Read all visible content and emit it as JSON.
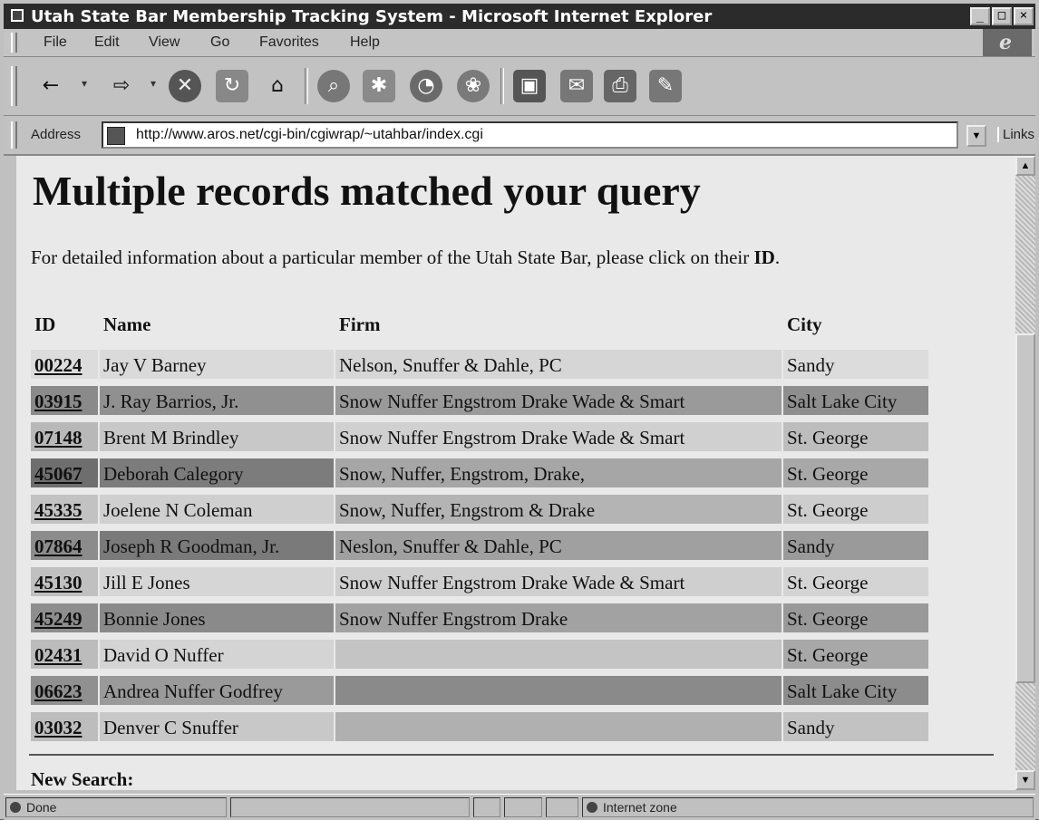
{
  "window": {
    "title": "Utah State Bar Membership Tracking System - Microsoft Internet Explorer"
  },
  "menu": [
    "File",
    "Edit",
    "View",
    "Go",
    "Favorites",
    "Help"
  ],
  "toolbar_icons": [
    "back-icon",
    "forward-icon",
    "stop-icon",
    "refresh-icon",
    "home-icon",
    "search-icon",
    "favorites-icon",
    "history-icon",
    "channels-icon",
    "fullscreen-icon",
    "mail-icon",
    "print-icon",
    "edit-icon"
  ],
  "address": {
    "label": "Address",
    "url": "http://www.aros.net/cgi-bin/cgiwrap/~utahbar/index.cgi",
    "links": "Links"
  },
  "page": {
    "heading": "Multiple records matched your query",
    "intro": "For detailed information about a particular member of the Utah State Bar, please click on their ",
    "intro_id": "ID",
    "columns": {
      "id": "ID",
      "name": "Name",
      "firm": "Firm",
      "city": "City"
    },
    "rows": [
      {
        "id": "00224",
        "name": "Jay V Barney",
        "firm": "Nelson, Snuffer & Dahle, PC",
        "city": "Sandy"
      },
      {
        "id": "03915",
        "name": "J. Ray Barrios, Jr.",
        "firm": "Snow Nuffer Engstrom Drake Wade & Smart",
        "city": "Salt Lake City"
      },
      {
        "id": "07148",
        "name": "Brent M Brindley",
        "firm": "Snow Nuffer Engstrom Drake Wade & Smart",
        "city": "St. George"
      },
      {
        "id": "45067",
        "name": "Deborah Calegory",
        "firm": "Snow, Nuffer, Engstrom, Drake,",
        "city": "St. George"
      },
      {
        "id": "45335",
        "name": "Joelene N Coleman",
        "firm": "Snow, Nuffer, Engstrom & Drake",
        "city": "St. George"
      },
      {
        "id": "07864",
        "name": "Joseph R Goodman, Jr.",
        "firm": "Neslon, Snuffer & Dahle, PC",
        "city": "Sandy"
      },
      {
        "id": "45130",
        "name": "Jill E Jones",
        "firm": "Snow Nuffer Engstrom Drake Wade & Smart",
        "city": "St. George"
      },
      {
        "id": "45249",
        "name": "Bonnie Jones",
        "firm": "Snow Nuffer Engstrom Drake",
        "city": "St. George"
      },
      {
        "id": "02431",
        "name": "David O Nuffer",
        "firm": "",
        "city": "St. George"
      },
      {
        "id": "06623",
        "name": "Andrea Nuffer Godfrey",
        "firm": "",
        "city": "Salt Lake City"
      },
      {
        "id": "03032",
        "name": "Denver C Snuffer",
        "firm": "",
        "city": "Sandy"
      }
    ],
    "new_search": "New Search:"
  },
  "status": {
    "text": "Done",
    "zone": "Internet zone"
  }
}
